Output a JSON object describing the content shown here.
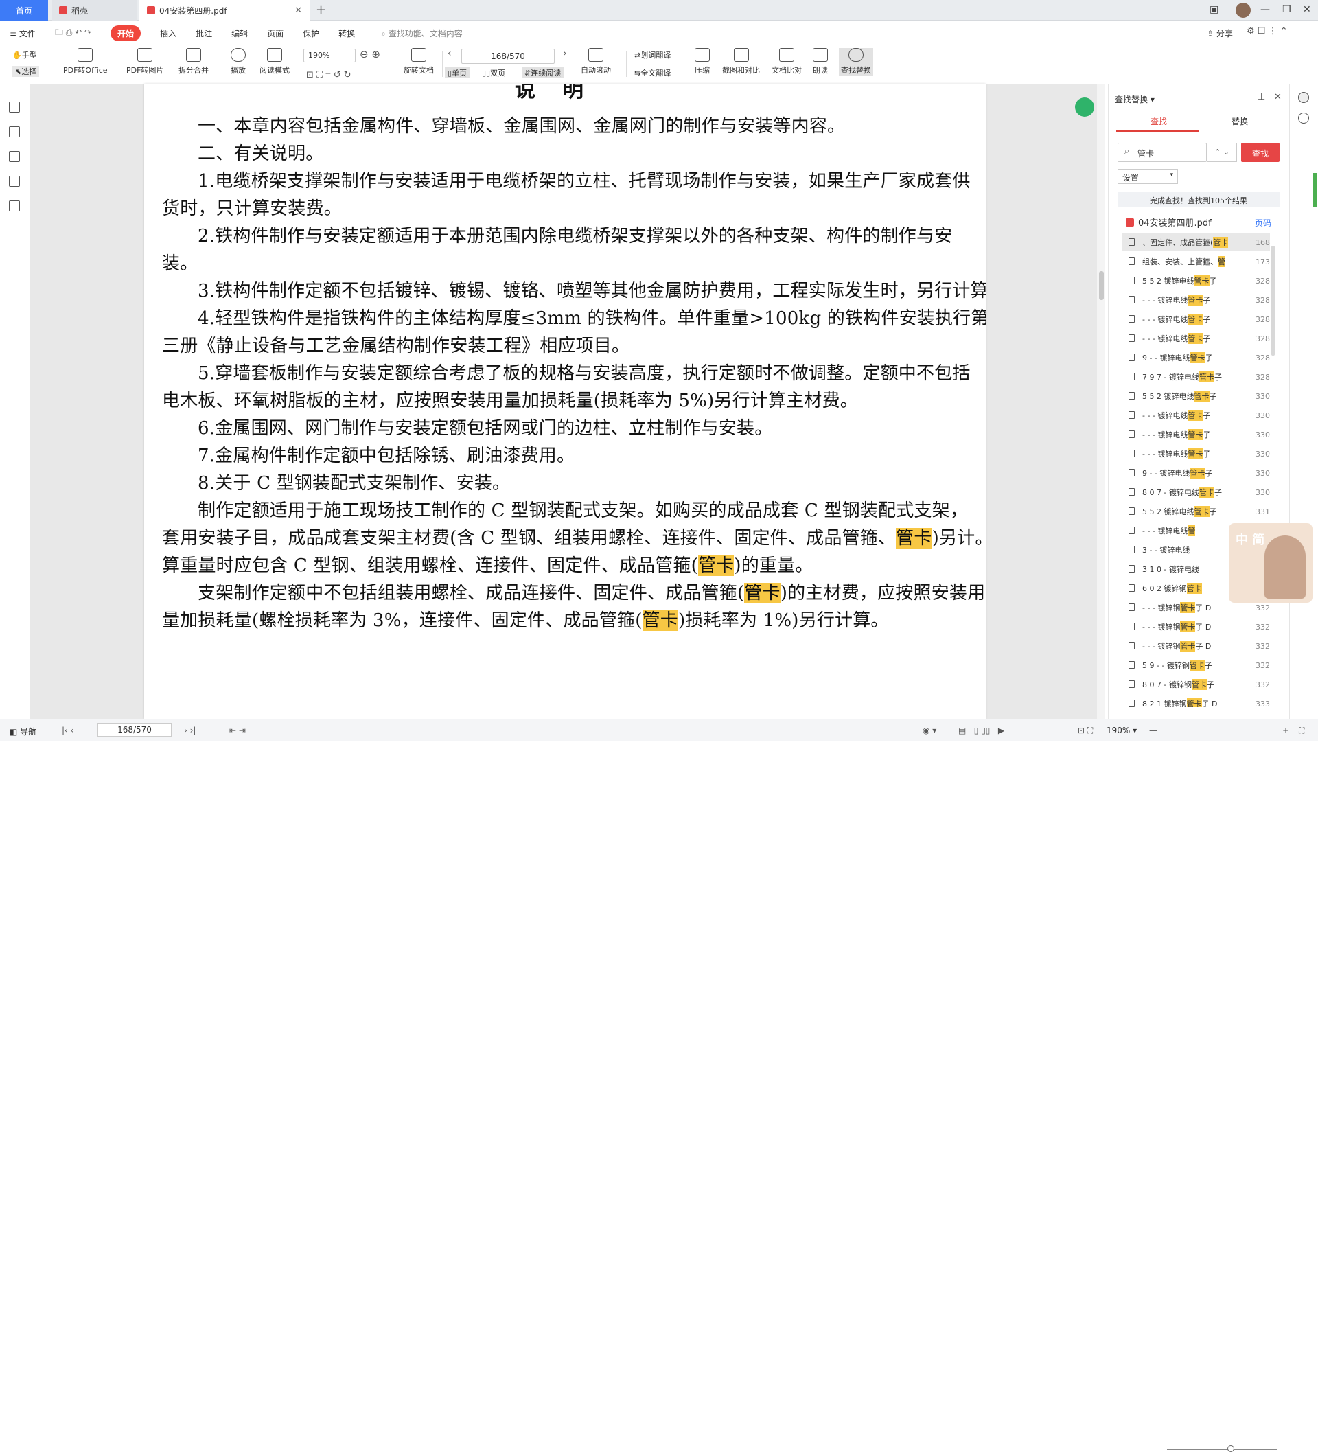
{
  "tabs": {
    "home": "首页",
    "docer": "稻壳",
    "pdf": "04安装第四册.pdf"
  },
  "menu": [
    "文件",
    "开始",
    "插入",
    "批注",
    "编辑",
    "页面",
    "保护",
    "转换"
  ],
  "menu_active": "开始",
  "search_placeholder": "查找功能、文档内容",
  "share_label": "分享",
  "toolbar": {
    "hand": "手型",
    "select": "选择",
    "pdf_office": "PDF转Office",
    "pdf_image": "PDF转图片",
    "split_merge": "拆分合并",
    "play": "播放",
    "read_mode": "阅读模式",
    "zoom": "190%",
    "rotate": "旋转文档",
    "single": "单页",
    "double": "双页",
    "continuous": "连续阅读",
    "auto_scroll": "自动滚动",
    "word_translate": "划词翻译",
    "full_translate": "全文翻译",
    "compress": "压缩",
    "screenshot_compare": "截图和对比",
    "doc_compare": "文档比对",
    "read_aloud": "朗读",
    "find_replace": "查找替换",
    "page": "168/570"
  },
  "document": {
    "heading": "说明",
    "lines": [
      {
        "indent": true,
        "parts": [
          {
            "t": "一、本章内容包括金属构件、穿墙板、金属围网、金属网门的制作与安装等内容。"
          }
        ]
      },
      {
        "indent": true,
        "parts": [
          {
            "t": "二、有关说明。"
          }
        ]
      },
      {
        "indent": true,
        "parts": [
          {
            "t": "1.电缆桥架支撑架制作与安装适用于电缆桥架的立柱、托臂现场制作与安装，如果生产厂家成套供"
          }
        ]
      },
      {
        "indent": false,
        "parts": [
          {
            "t": "货时，只计算安装费。"
          }
        ]
      },
      {
        "indent": true,
        "parts": [
          {
            "t": "2.铁构件制作与安装定额适用于本册范围内除电缆桥架支撑架以外的各种支架、构件的制作与安"
          }
        ]
      },
      {
        "indent": false,
        "parts": [
          {
            "t": "装。"
          }
        ]
      },
      {
        "indent": true,
        "parts": [
          {
            "t": "3.铁构件制作定额不包括镀锌、镀锡、镀铬、喷塑等其他金属防护费用，工程实际发生时，另行计算。"
          }
        ]
      },
      {
        "indent": true,
        "parts": [
          {
            "t": "4.轻型铁构件是指铁构件的主体结构厚度≤3mm 的铁构件。单件重量>100kg 的铁构件安装执行第"
          }
        ]
      },
      {
        "indent": false,
        "parts": [
          {
            "t": "三册《静止设备与工艺金属结构制作安装工程》相应项目。"
          }
        ]
      },
      {
        "indent": true,
        "parts": [
          {
            "t": "5.穿墙套板制作与安装定额综合考虑了板的规格与安装高度，执行定额时不做调整。定额中不包括"
          }
        ]
      },
      {
        "indent": false,
        "parts": [
          {
            "t": "电木板、环氧树脂板的主材，应按照安装用量加损耗量(损耗率为 5%)另行计算主材费。"
          }
        ]
      },
      {
        "indent": true,
        "parts": [
          {
            "t": "6.金属围网、网门制作与安装定额包括网或门的边柱、立柱制作与安装。"
          }
        ]
      },
      {
        "indent": true,
        "parts": [
          {
            "t": "7.金属构件制作定额中包括除锈、刷油漆费用。"
          }
        ]
      },
      {
        "indent": true,
        "parts": [
          {
            "t": "8.关于 C 型钢装配式支架制作、安装。"
          }
        ]
      },
      {
        "indent": true,
        "parts": [
          {
            "t": "制作定额适用于施工现场技工制作的 C 型钢装配式支架。如购买的成品成套 C 型钢装配式支架，"
          }
        ]
      },
      {
        "indent": false,
        "parts": [
          {
            "t": "套用安装子目，成品成套支架主材费(含 C 型钢、组装用螺栓、连接件、固定件、成品管箍、"
          },
          {
            "t": "管卡",
            "hl": true
          },
          {
            "t": ")另计。计"
          }
        ]
      },
      {
        "indent": false,
        "parts": [
          {
            "t": "算重量时应包含 C 型钢、组装用螺栓、连接件、固定件、成品管箍("
          },
          {
            "t": "管卡",
            "hl": true
          },
          {
            "t": ")的重量。"
          }
        ]
      },
      {
        "indent": true,
        "parts": [
          {
            "t": "支架制作定额中不包括组装用螺栓、成品连接件、固定件、成品管箍("
          },
          {
            "t": "管卡",
            "hl": true
          },
          {
            "t": ")的主材费，应按照安装用"
          }
        ]
      },
      {
        "indent": false,
        "parts": [
          {
            "t": "量加损耗量(螺栓损耗率为 3%，连接件、固定件、成品管箍("
          },
          {
            "t": "管卡",
            "hl": true
          },
          {
            "t": ")损耗率为 1%)另行计算。"
          }
        ]
      }
    ]
  },
  "find_panel": {
    "title": "查找替换",
    "tab_find": "查找",
    "tab_replace": "替换",
    "query": "管卡",
    "find_button": "查找",
    "settings": "设置",
    "summary": "完成查找！查找到105个结果",
    "file_name": "04安装第四册.pdf",
    "page_label": "页码",
    "results": [
      {
        "pre": "、固定件、成品管箍(",
        "hit": "管卡",
        "post": "",
        "page": "168",
        "selected": true
      },
      {
        "pre": "组装、安装、上管箍、",
        "hit": "管",
        "post": "",
        "page": "173"
      },
      {
        "pre": "5 5 2  镀锌电线",
        "hit": "管卡",
        "post": "子",
        "page": "328"
      },
      {
        "pre": "- - -  镀锌电线",
        "hit": "管卡",
        "post": "子",
        "page": "328"
      },
      {
        "pre": "- - -  镀锌电线",
        "hit": "管卡",
        "post": "子",
        "page": "328"
      },
      {
        "pre": "- - -  镀锌电线",
        "hit": "管卡",
        "post": "子",
        "page": "328"
      },
      {
        "pre": "9  -  -  镀锌电线",
        "hit": "管卡",
        "post": "子",
        "page": "328"
      },
      {
        "pre": "7 9 7  -  镀锌电线",
        "hit": "管卡",
        "post": "子",
        "page": "328"
      },
      {
        "pre": "5 5 2  镀锌电线",
        "hit": "管卡",
        "post": "子",
        "page": "330"
      },
      {
        "pre": "- - -  镀锌电线",
        "hit": "管卡",
        "post": "子",
        "page": "330"
      },
      {
        "pre": "- - -  镀锌电线",
        "hit": "管卡",
        "post": "子",
        "page": "330"
      },
      {
        "pre": "- - -  镀锌电线",
        "hit": "管卡",
        "post": "子",
        "page": "330"
      },
      {
        "pre": "9  -  -  镀锌电线",
        "hit": "管卡",
        "post": "子",
        "page": "330"
      },
      {
        "pre": "8 0 7  -  镀锌电线",
        "hit": "管卡",
        "post": "子",
        "page": "330"
      },
      {
        "pre": "5 5 2  镀锌电线",
        "hit": "管卡",
        "post": "子",
        "page": "331"
      },
      {
        "pre": "- - -  镀锌电线",
        "hit": "管",
        "post": "",
        "page": ""
      },
      {
        "pre": "3  -  -  镀锌电线",
        "hit": "",
        "post": "",
        "page": ""
      },
      {
        "pre": "3 1 0  -  镀锌电线",
        "hit": "",
        "post": "",
        "page": ""
      },
      {
        "pre": "6 0 2  镀锌钢",
        "hit": "管卡",
        "post": "",
        "page": ""
      },
      {
        "pre": "- - -  镀锌钢",
        "hit": "管卡",
        "post": "子 D",
        "page": "332"
      },
      {
        "pre": "- - -  镀锌钢",
        "hit": "管卡",
        "post": "子 D",
        "page": "332"
      },
      {
        "pre": "- - -  镀锌钢",
        "hit": "管卡",
        "post": "子 D",
        "page": "332"
      },
      {
        "pre": "5 9  -  -  镀锌钢",
        "hit": "管卡",
        "post": "子",
        "page": "332"
      },
      {
        "pre": "8 0 7  -  镀锌钢",
        "hit": "管卡",
        "post": "子",
        "page": "332"
      },
      {
        "pre": "8 2 1  镀锌钢",
        "hit": "管卡",
        "post": "子 D",
        "page": "333"
      }
    ]
  },
  "avatar_widget_text": "中 简",
  "statusbar": {
    "nav": "导航",
    "page": "168/570",
    "zoom": "190%"
  }
}
